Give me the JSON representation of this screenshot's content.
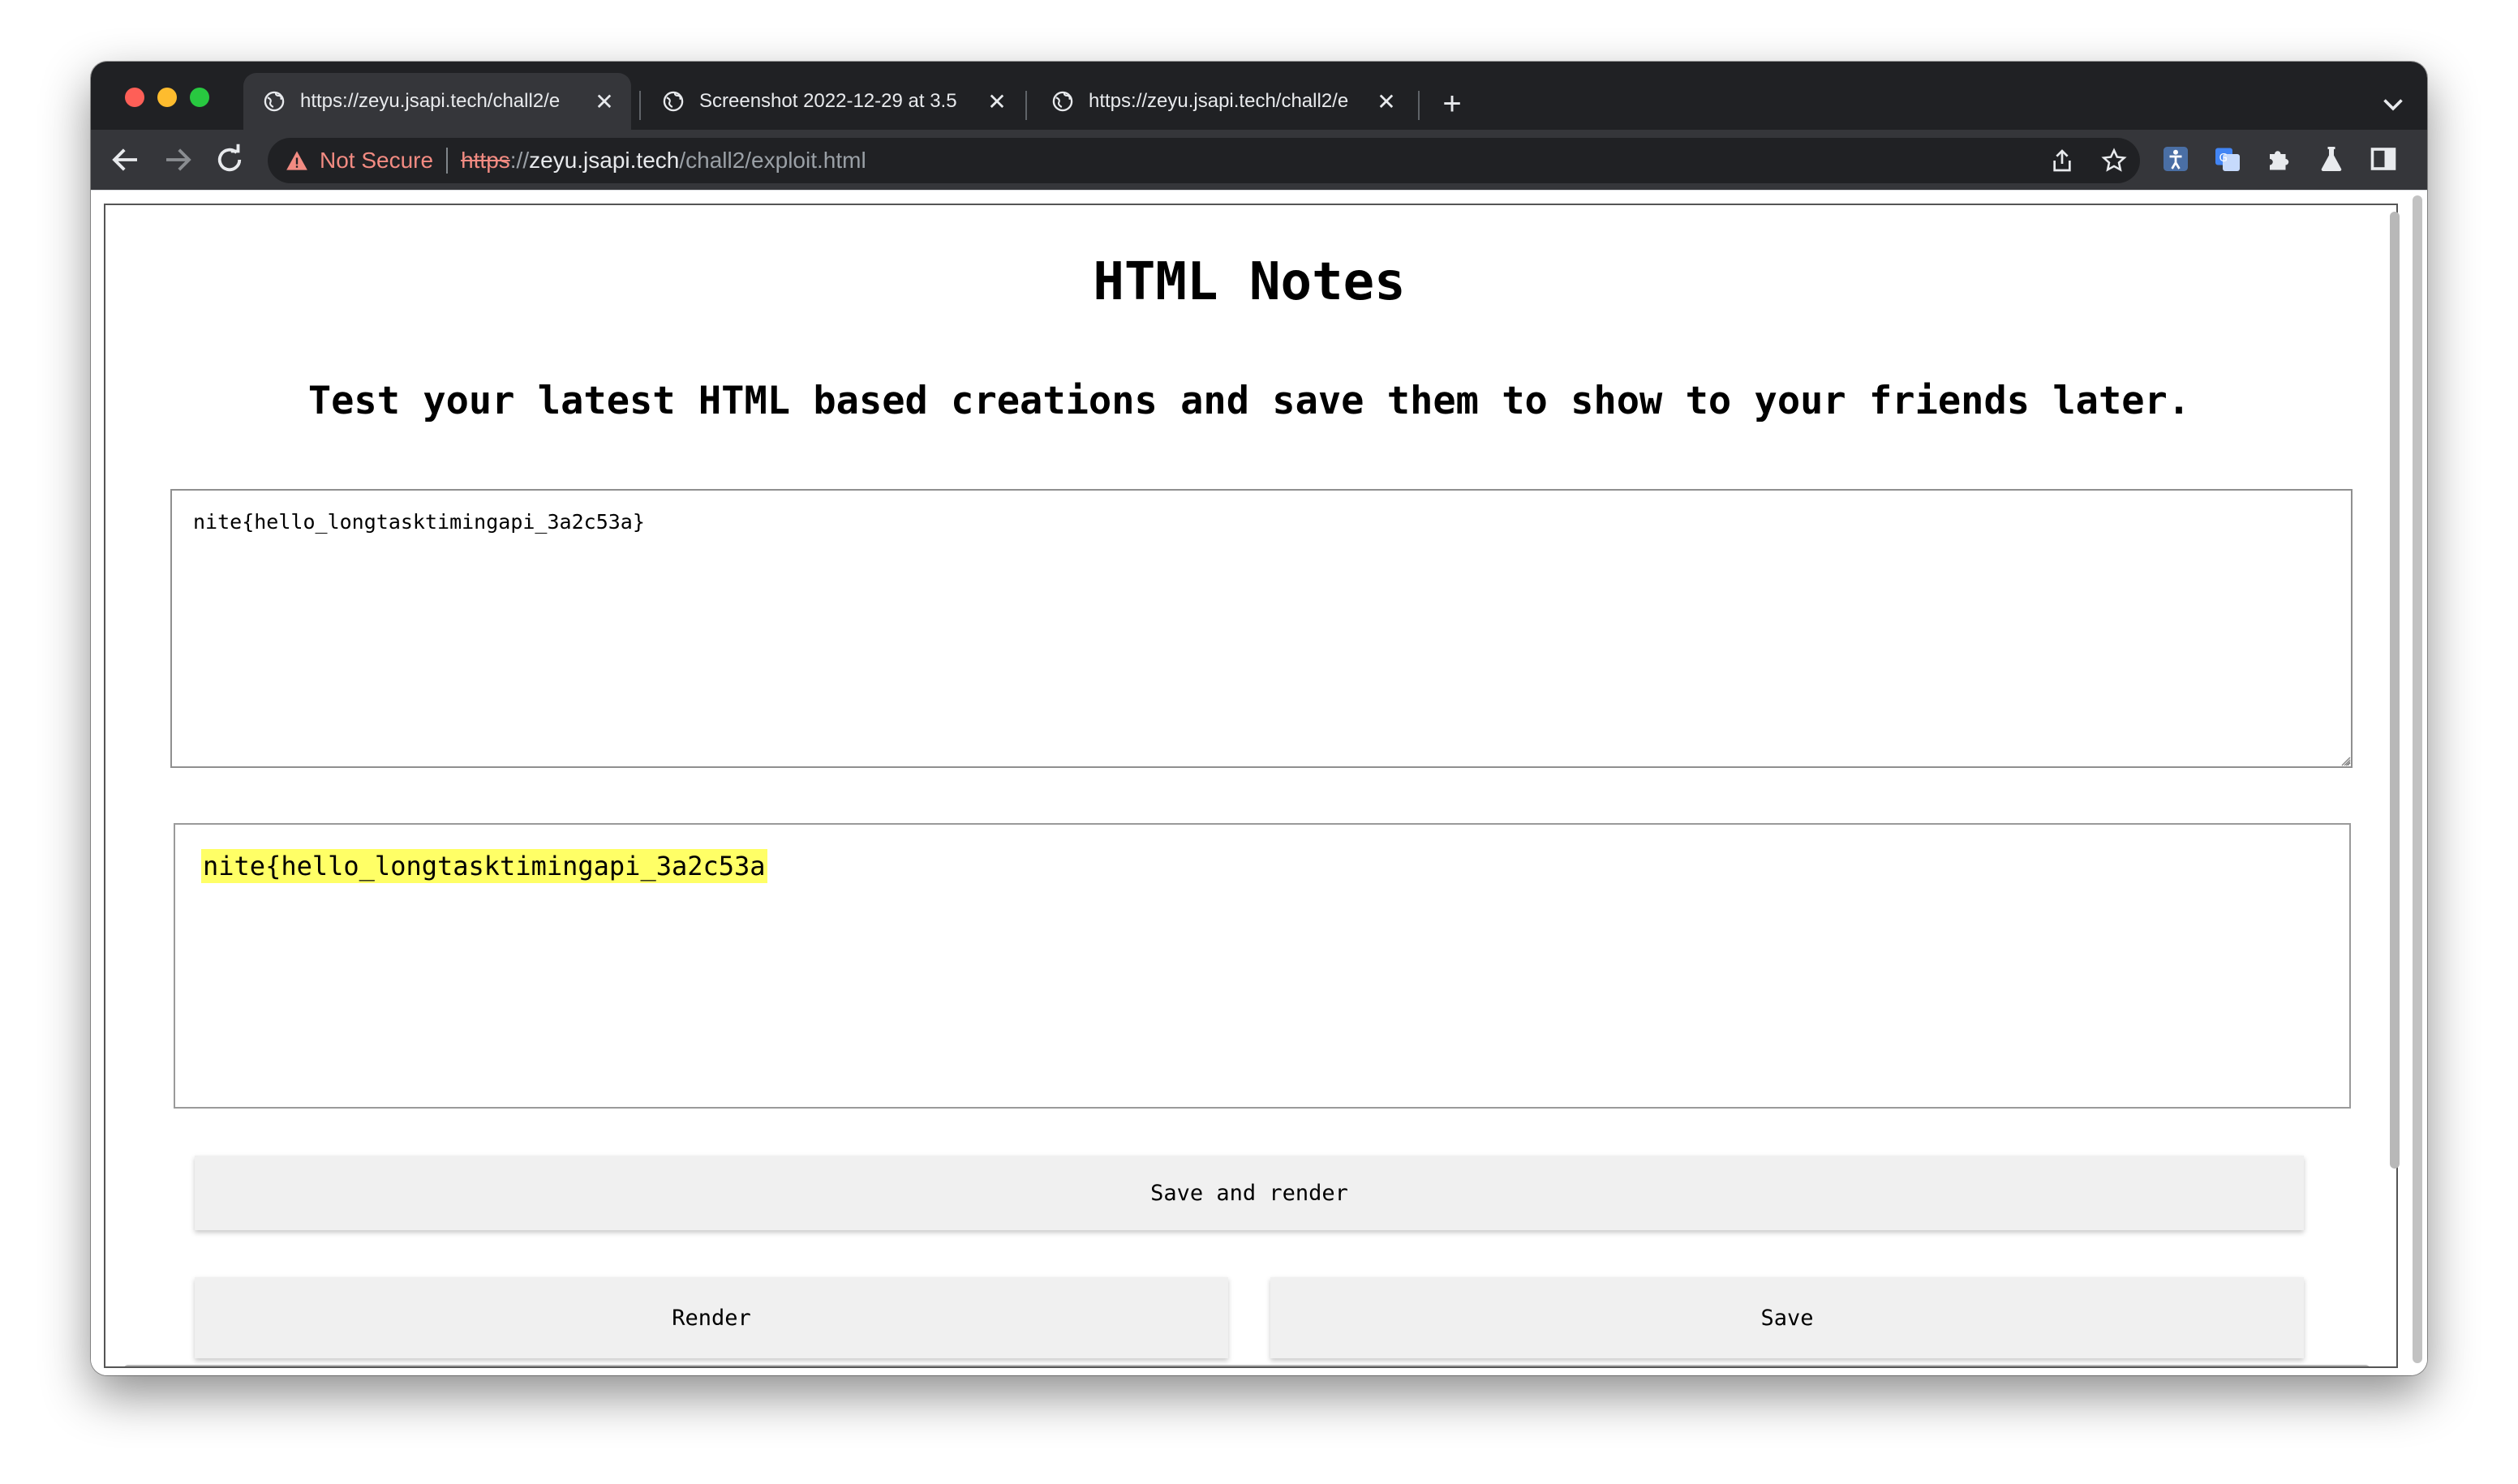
{
  "browser": {
    "tabs": [
      {
        "label": "https://zeyu.jsapi.tech/chall2/e",
        "active": true
      },
      {
        "label": "Screenshot 2022-12-29 at 3.5",
        "active": false
      },
      {
        "label": "https://zeyu.jsapi.tech/chall2/e",
        "active": false
      }
    ],
    "security_label": "Not Secure",
    "url": {
      "scheme": "https",
      "separator": "://",
      "host": "zeyu.jsapi.tech",
      "path": "/chall2/exploit.html"
    }
  },
  "page": {
    "title": "HTML Notes",
    "subtitle": "Test your latest HTML based creations and save them to show to your friends later.",
    "editor_value": "nite{hello_longtasktimingapi_3a2c53a}",
    "preview_text": "nite{hello_longtasktimingapi_3a2c53a",
    "highlight_color": "#ffff66",
    "buttons": {
      "save_and_render": "Save and render",
      "render": "Render",
      "save": "Save"
    }
  },
  "colors": {
    "tabstrip": "#202124",
    "toolbar": "#35363a",
    "warning": "#f28b82"
  }
}
